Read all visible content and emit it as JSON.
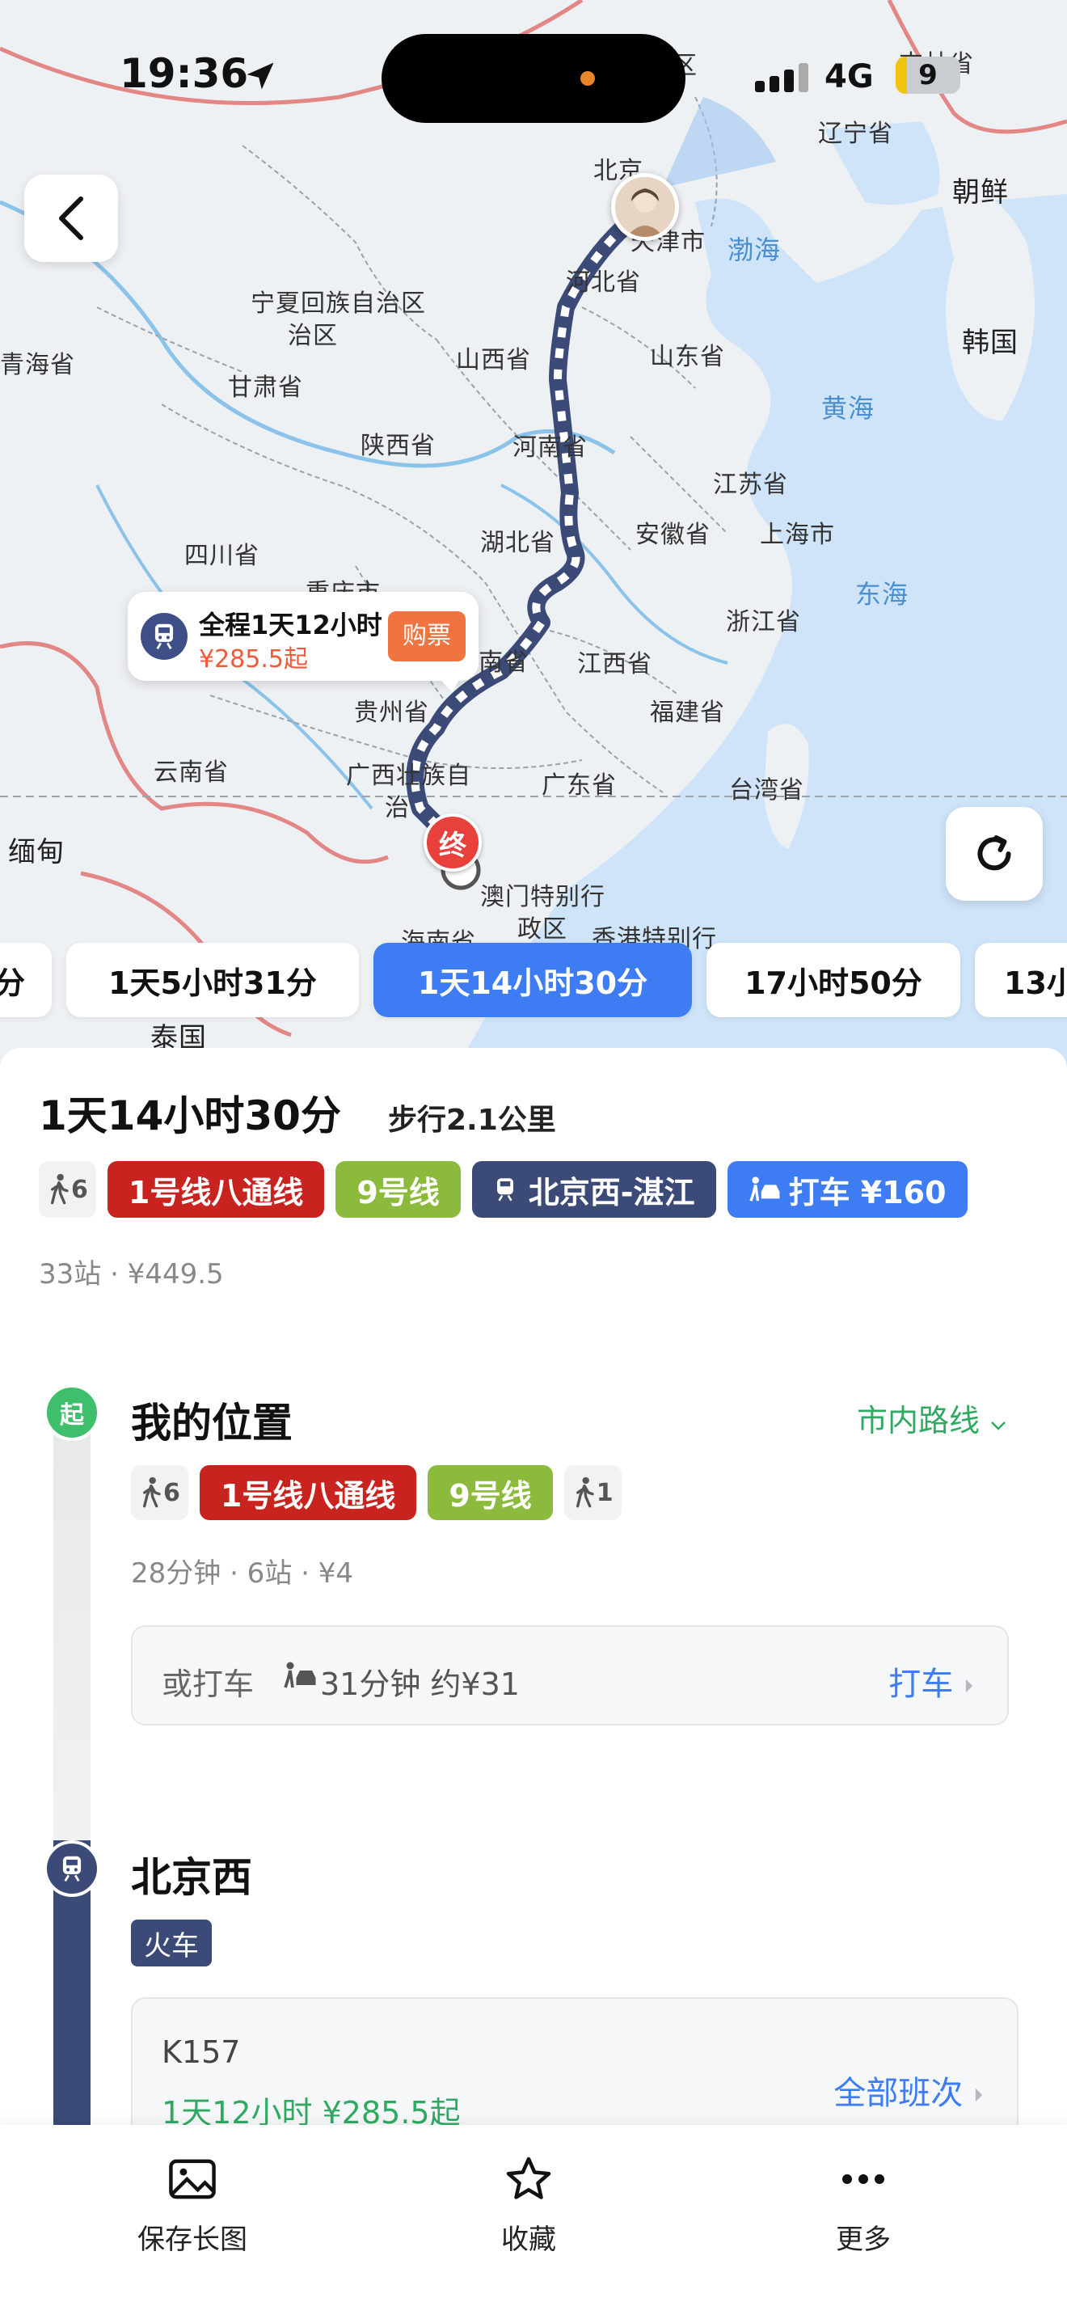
{
  "status_bar": {
    "time": "19:36",
    "network": "4G",
    "battery": "9"
  },
  "map": {
    "labels": {
      "beijing": "北京",
      "tianjin": "天津市",
      "hebei": "河北省",
      "liaoning": "辽宁省",
      "jilin": "吉林省",
      "chaoxian": "朝鲜",
      "hanguo": "韩国",
      "bohai": "渤海",
      "huanghai": "黄海",
      "donghai": "东海",
      "shandong": "山东省",
      "jiangsu": "江苏省",
      "shanghai": "上海市",
      "anhui": "安徽省",
      "zhejiang": "浙江省",
      "henan": "河南省",
      "hubei": "湖北省",
      "shanxi": "山西省",
      "shaanxi": "陕西省",
      "ningxia": "宁夏回族自治区",
      "ningxia2": "治区",
      "gansu": "甘肃省",
      "qinghai": "青海省",
      "sichuan": "四川省",
      "chongqing": "重庆市",
      "guizhou": "贵州省",
      "yunnan": "云南省",
      "guangxi": "广西壮族自",
      "guangxi2": "治",
      "guangdong": "广东省",
      "jiangxi": "江西省",
      "fujian": "福建省",
      "taiwan": "台湾省",
      "hunan": "南省",
      "miandian": "缅甸",
      "aomen": "澳门特别行",
      "aomen2": "政区",
      "xianggang": "香港特别行",
      "hainan": "海南省",
      "taiguo": "泰国",
      "qu": "区"
    },
    "ticket_bubble": {
      "line1": "全程1天12小时",
      "line2": "¥285.5起",
      "buy": "购票"
    },
    "end_marker": "终"
  },
  "route_options": [
    {
      "label": "分"
    },
    {
      "label": "1天5小时31分"
    },
    {
      "label": "1天14小时30分",
      "active": true
    },
    {
      "label": "17小时50分"
    },
    {
      "label": "13小"
    }
  ],
  "summary": {
    "duration": "1天14小时30分",
    "walk": "步行2.1公里",
    "walk_tag": "6",
    "tags": [
      "1号线八通线",
      "9号线",
      "北京西-湛江",
      "打车 ¥160"
    ],
    "stats": "33站 · ¥449.5"
  },
  "segments": {
    "start": {
      "node": "起",
      "title": "我的位置",
      "city_route": "市内路线",
      "walk1": "6",
      "line1": "1号线八通线",
      "line2": "9号线",
      "walk2": "1",
      "stats": "28分钟 · 6站 · ¥4",
      "taxi_label": "或打车",
      "taxi_info": "31分钟 约¥31",
      "taxi_button": "打车"
    },
    "station": {
      "title": "北京西",
      "badge": "火车",
      "train_code": "K157",
      "train_info": "1天12小时 ¥285.5起",
      "all_trains": "全部班次"
    }
  },
  "bottom_bar": {
    "save": "保存长图",
    "favorite": "收藏",
    "more": "更多"
  }
}
